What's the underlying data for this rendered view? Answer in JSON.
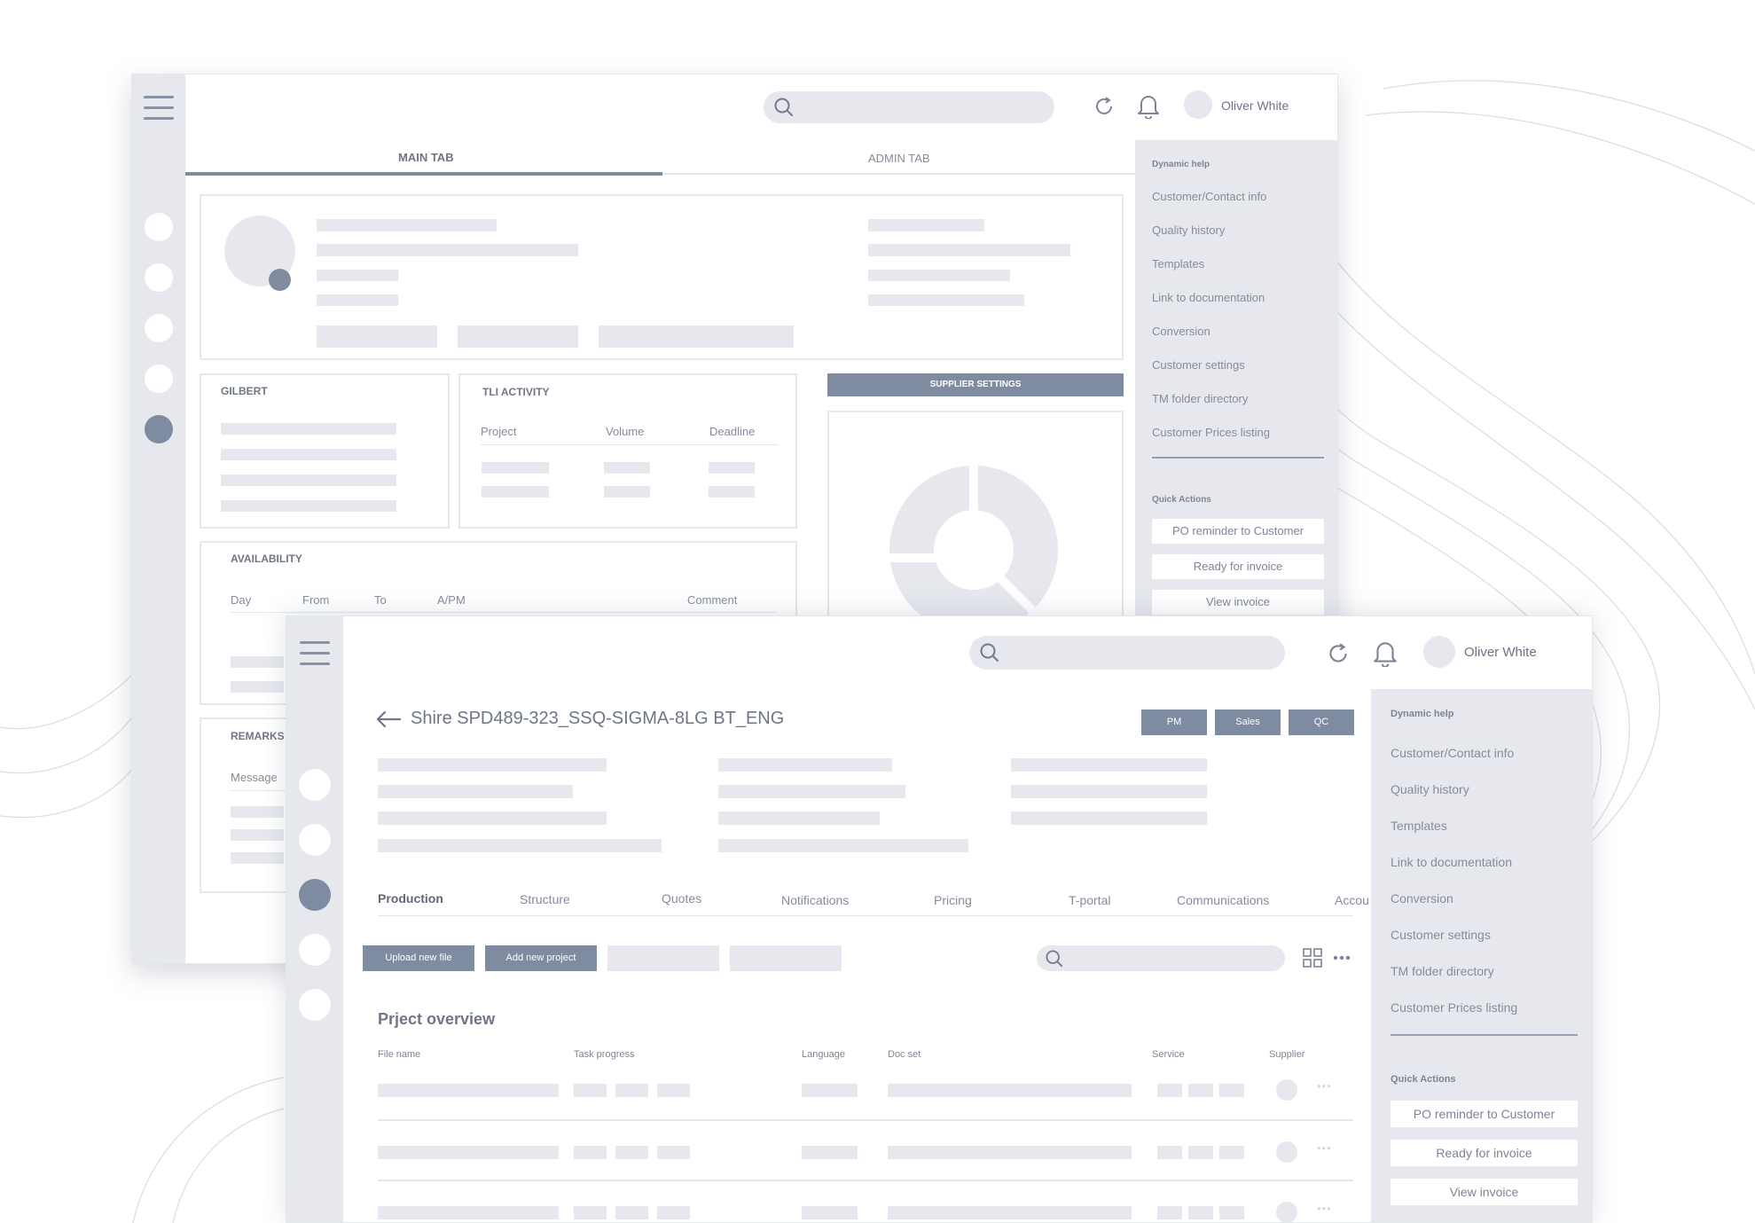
{
  "user": {
    "name": "Oliver White"
  },
  "colors": {
    "accent": "#7e8ba1",
    "panel": "#e6e8ee",
    "placeholder": "#e6e8ee"
  },
  "icons": [
    "menu-icon",
    "search-icon",
    "refresh-icon",
    "bell-icon",
    "grid-icon",
    "more-icon",
    "back-arrow-icon"
  ],
  "dashboard": {
    "tabs": {
      "main": "MAIN TAB",
      "admin": "ADMIN TAB"
    },
    "cards": {
      "gilbert": "GILBERT",
      "tli": "TLI ACTIVITY",
      "tli_columns": [
        "Project",
        "Volume",
        "Deadline"
      ],
      "supplier_settings": "SUPPLIER SETTINGS",
      "availability": "AVAILABILITY",
      "availability_columns": [
        "Day",
        "From",
        "To",
        "A/PM",
        "Comment"
      ],
      "remarks": "REMARKS",
      "remarks_column": "Message"
    }
  },
  "side_panel": {
    "dynamic_help_title": "Dynamic help",
    "items": [
      "Customer/Contact info",
      "Quality history",
      "Templates",
      "Link to documentation",
      "Conversion",
      "Customer settings",
      "TM folder directory",
      "Customer Prices listing"
    ],
    "quick_actions_title": "Quick Actions",
    "actions": [
      "PO reminder to Customer",
      "Ready for invoice",
      "View invoice"
    ]
  },
  "project": {
    "title": "Shire SPD489-323_SSQ-SIGMA-8LG BT_ENG",
    "role_buttons": [
      "PM",
      "Sales",
      "QC"
    ],
    "tabs": [
      "Production",
      "Structure",
      "Quotes",
      "Notifications",
      "Pricing",
      "T-portal",
      "Communications",
      "Accou"
    ],
    "toolbar": {
      "upload": "Upload new file",
      "add": "Add new project"
    },
    "overview_title": "Prject overview",
    "columns": [
      "File name",
      "Task progress",
      "Language",
      "Doc set",
      "Service",
      "Supplier"
    ]
  }
}
